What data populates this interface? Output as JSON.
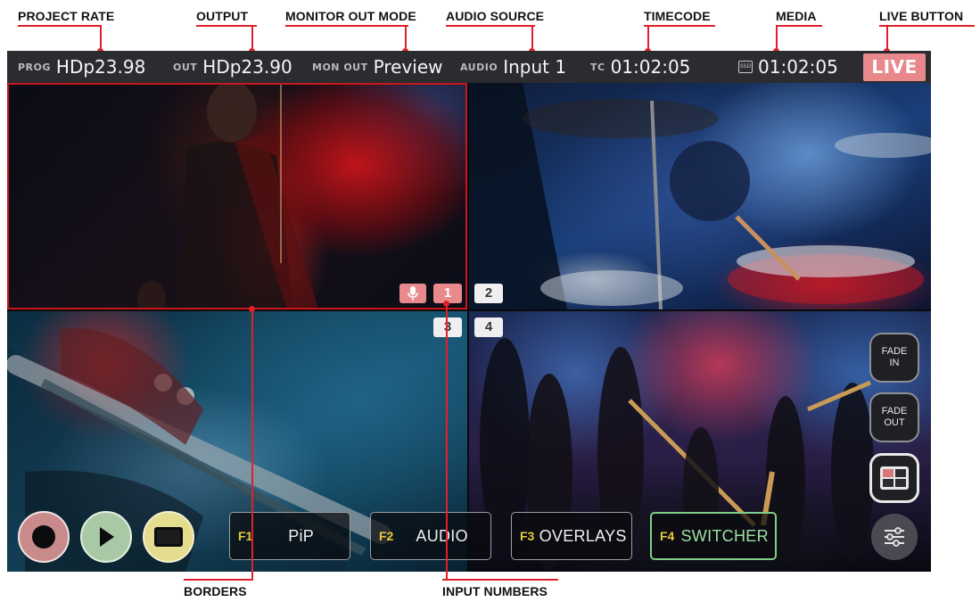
{
  "callouts": {
    "project_rate": "PROJECT RATE",
    "output": "OUTPUT",
    "monitor_out_mode": "MONITOR OUT MODE",
    "audio_source": "AUDIO SOURCE",
    "timecode": "TIMECODE",
    "media": "MEDIA",
    "live_button": "LIVE BUTTON",
    "borders": "BORDERS",
    "input_numbers": "INPUT NUMBERS"
  },
  "topbar": {
    "prog_label": "PROG",
    "prog_value": "HDp23.98",
    "out_label": "OUT",
    "out_value": "HDp23.90",
    "mon_out_label": "MON OUT",
    "mon_out_value": "Preview",
    "audio_label": "AUDIO",
    "audio_value": "Input 1",
    "tc_label": "TC",
    "tc_value": "01:02:05",
    "media_icon_label": "SSD",
    "media_value": "01:02:05",
    "live_label": "LIVE"
  },
  "inputs": {
    "input_1": "1",
    "input_2": "2",
    "input_3": "3",
    "input_4": "4"
  },
  "side_buttons": {
    "fade_in": "FADE IN",
    "fade_out": "FADE OUT"
  },
  "function_buttons": [
    {
      "key": "F1",
      "label": "PiP"
    },
    {
      "key": "F2",
      "label": "AUDIO"
    },
    {
      "key": "F3",
      "label": "OVERLAYS"
    },
    {
      "key": "F4",
      "label": "SWITCHER"
    }
  ],
  "colors": {
    "live_pink": "#e8888a",
    "border_red": "#c8161e",
    "fkey_yellow": "#e8c93a",
    "switcher_green": "#7fcf8a",
    "record_pink": "#c98a8c",
    "play_green": "#a9c8a6",
    "monitor_yellow": "#e4dc8f"
  },
  "icons": [
    "record-icon",
    "play-icon",
    "monitor-icon",
    "microphone-icon",
    "split-view-icon",
    "settings-sliders-icon",
    "ssd-icon"
  ]
}
